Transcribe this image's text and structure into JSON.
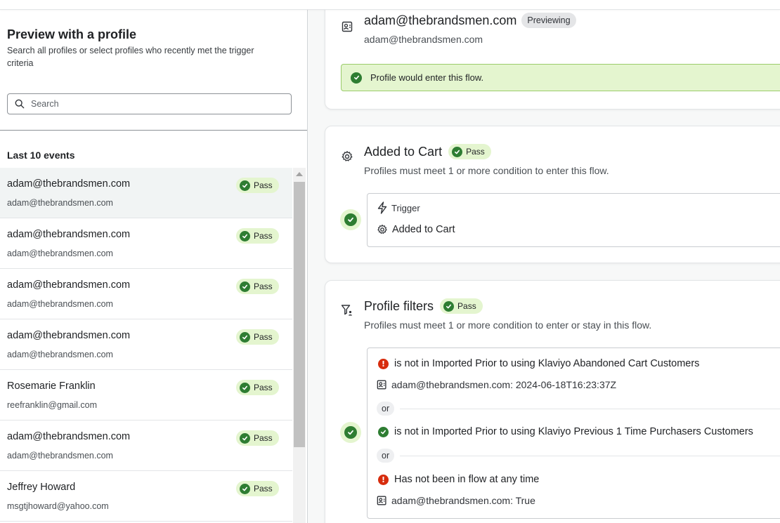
{
  "left_panel": {
    "title": "Preview with a profile",
    "subtitle": "Search all profiles or select profiles who recently met the trigger criteria",
    "search_placeholder": "Search",
    "events_title": "Last 10 events",
    "events": [
      {
        "name": "adam@thebrandsmen.com",
        "email": "adam@thebrandsmen.com",
        "status": "Pass",
        "selected": true
      },
      {
        "name": "adam@thebrandsmen.com",
        "email": "adam@thebrandsmen.com",
        "status": "Pass"
      },
      {
        "name": "adam@thebrandsmen.com",
        "email": "adam@thebrandsmen.com",
        "status": "Pass"
      },
      {
        "name": "adam@thebrandsmen.com",
        "email": "adam@thebrandsmen.com",
        "status": "Pass"
      },
      {
        "name": "Rosemarie Franklin",
        "email": "reefranklin@gmail.com",
        "status": "Pass"
      },
      {
        "name": "adam@thebrandsmen.com",
        "email": "adam@thebrandsmen.com",
        "status": "Pass"
      },
      {
        "name": "Jeffrey Howard",
        "email": "msgtjhoward@yahoo.com",
        "status": "Pass"
      }
    ]
  },
  "profile_card": {
    "name": "adam@thebrandsmen.com",
    "badge": "Previewing",
    "email": "adam@thebrandsmen.com",
    "alert": "Profile would enter this flow."
  },
  "trigger_card": {
    "title": "Added to Cart",
    "badge": "Pass",
    "subtitle": "Profiles must meet 1 or more condition to enter this flow.",
    "trigger_label": "Trigger",
    "trigger_value": "Added to Cart"
  },
  "filters_card": {
    "title": "Profile filters",
    "badge": "Pass",
    "subtitle": "Profiles must meet 1 or more condition to enter or stay in this flow.",
    "or_label": "or",
    "conditions": [
      {
        "text": "is not in Imported Prior to using Klaviyo Abandoned Cart Customers",
        "detail": "adam@thebrandsmen.com: 2024-06-18T16:23:37Z",
        "status": "fail"
      },
      {
        "text": "is not in Imported Prior to using Klaviyo Previous 1 Time Purchasers Customers",
        "status": "pass"
      },
      {
        "text": "Has not been in flow at any time",
        "detail": "adam@thebrandsmen.com: True",
        "status": "fail"
      }
    ]
  },
  "colors": {
    "pass_green": "#2e7d32",
    "pass_bg": "#e4f5cf",
    "error_red": "#d72c0d",
    "selected_row_bg": "#f1f4f4"
  }
}
